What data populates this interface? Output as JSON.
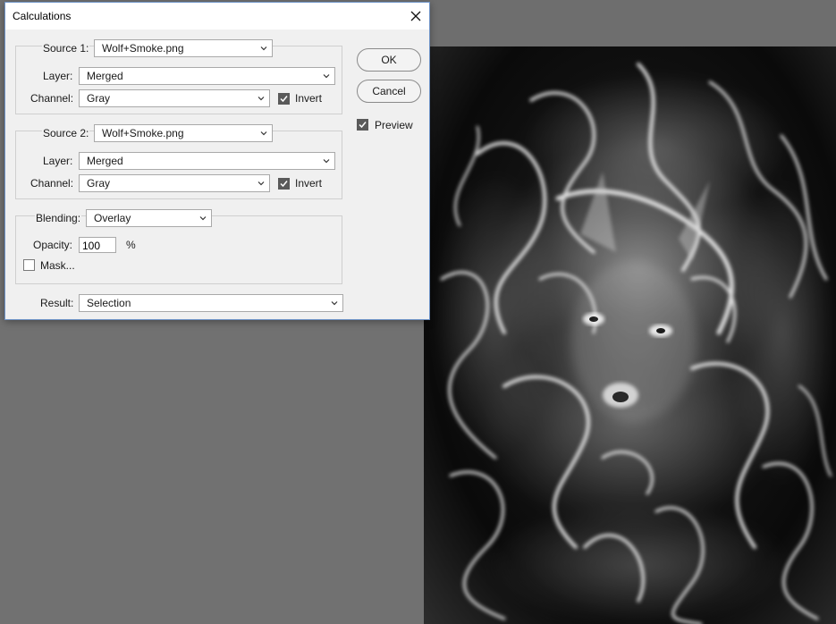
{
  "dialog": {
    "title": "Calculations",
    "close_glyph": "×",
    "source1": {
      "label": "Source 1:",
      "file": "Wolf+Smoke.png",
      "layer_label": "Layer:",
      "layer": "Merged",
      "channel_label": "Channel:",
      "channel": "Gray",
      "invert_label": "Invert",
      "invert_checked": true
    },
    "source2": {
      "label": "Source 2:",
      "file": "Wolf+Smoke.png",
      "layer_label": "Layer:",
      "layer": "Merged",
      "channel_label": "Channel:",
      "channel": "Gray",
      "invert_label": "Invert",
      "invert_checked": true
    },
    "blending": {
      "label": "Blending:",
      "mode": "Overlay",
      "opacity_label": "Opacity:",
      "opacity": "100",
      "opacity_unit": "%",
      "mask_label": "Mask...",
      "mask_checked": false
    },
    "result": {
      "label": "Result:",
      "value": "Selection"
    },
    "buttons": {
      "ok": "OK",
      "cancel": "Cancel"
    },
    "preview": {
      "label": "Preview",
      "checked": true
    }
  },
  "canvas": {
    "subject": "wolf-smoke-image",
    "background_color": "#0a0a0a",
    "smoke_color": "#f2f2f2"
  },
  "colors": {
    "workspace": "#717171",
    "dialog_bg": "#f0f0f0",
    "dialog_border": "#6e93c7",
    "checkbox_on": "#5a5a5a"
  }
}
